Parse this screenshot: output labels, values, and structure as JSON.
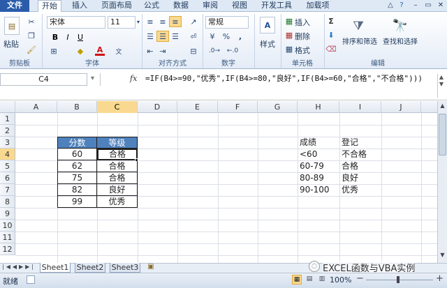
{
  "ribbon_tabs": [
    "文件",
    "开始",
    "插入",
    "页面布局",
    "公式",
    "数据",
    "审阅",
    "视图",
    "开发工具",
    "加载项"
  ],
  "clipboard": {
    "paste": "粘贴",
    "group": "剪贴板"
  },
  "font": {
    "name": "宋体",
    "size": "11",
    "group": "字体",
    "bold": "B",
    "italic": "I",
    "underline": "U",
    "grow": "A",
    "shrink": "A",
    "color_a": "A"
  },
  "alignment": {
    "group": "对齐方式"
  },
  "number": {
    "format": "常规",
    "currency": "¥",
    "percent": "%",
    "comma": ",",
    "group": "数字"
  },
  "styles": {
    "label": "样式"
  },
  "cells": {
    "insert": "插入",
    "delete": "删除",
    "format": "格式",
    "group": "单元格"
  },
  "editing": {
    "sigma": "Σ",
    "sort": "排序和筛选",
    "find": "查找和选择",
    "group": "编辑"
  },
  "formula_bar": {
    "name_box": "C4",
    "fx": "fx",
    "formula": "=IF(B4>=90,\"优秀\",IF(B4>=80,\"良好\",IF(B4>=60,\"合格\",\"不合格\")))"
  },
  "grid": {
    "columns": [
      "A",
      "B",
      "C",
      "D",
      "E",
      "F",
      "G",
      "H",
      "I",
      "J"
    ],
    "rows": [
      "1",
      "2",
      "3",
      "4",
      "5",
      "6",
      "7",
      "8",
      "9",
      "10",
      "11",
      "12"
    ],
    "table_headers": [
      "分数",
      "等级"
    ],
    "table_rows": [
      [
        "60",
        "合格"
      ],
      [
        "62",
        "合格"
      ],
      [
        "75",
        "合格"
      ],
      [
        "82",
        "良好"
      ],
      [
        "99",
        "优秀"
      ]
    ],
    "ref_headers": [
      "成绩",
      "登记"
    ],
    "ref_rows": [
      [
        "<60",
        "不合格"
      ],
      [
        "60-79",
        "合格"
      ],
      [
        "80-89",
        "良好"
      ],
      [
        "90-100",
        "优秀"
      ]
    ]
  },
  "sheets": [
    "Sheet1",
    "Sheet2",
    "Sheet3"
  ],
  "status": {
    "ready": "就绪",
    "zoom": "100%",
    "minus": "−",
    "plus": "+"
  },
  "watermark": "EXCEL函数与VBA实例",
  "colors": {
    "header_fill": "#4f81bd",
    "header_text": "#ffffff",
    "selected_header": "#f9d98f",
    "file_tab": "#2a5caa"
  }
}
